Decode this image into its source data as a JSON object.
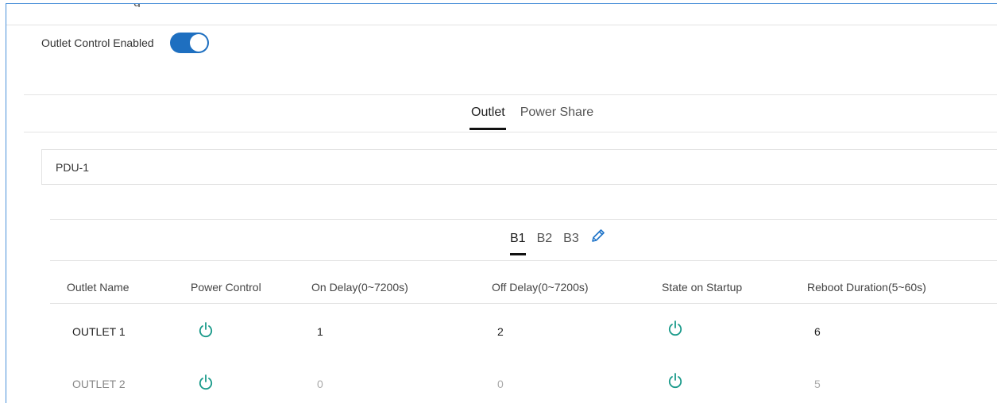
{
  "header": {
    "title_fragment": "g"
  },
  "outlet_control": {
    "label": "Outlet Control Enabled",
    "enabled": true
  },
  "main_tabs": [
    {
      "label": "Outlet",
      "active": true
    },
    {
      "label": "Power Share",
      "active": false
    }
  ],
  "pdu": {
    "name": "PDU-1"
  },
  "bank_tabs": [
    {
      "label": "B1",
      "active": true
    },
    {
      "label": "B2",
      "active": false
    },
    {
      "label": "B3",
      "active": false
    }
  ],
  "table": {
    "columns": [
      "Outlet Name",
      "Power Control",
      "On Delay(0~7200s)",
      "Off Delay(0~7200s)",
      "State on Startup",
      "Reboot Duration(5~60s)"
    ],
    "rows": [
      {
        "name": "OUTLET 1",
        "on_delay": "1",
        "off_delay": "2",
        "reboot": "6",
        "active": true
      },
      {
        "name": "OUTLET 2",
        "on_delay": "0",
        "off_delay": "0",
        "reboot": "5",
        "active": false
      }
    ]
  },
  "colors": {
    "toggle_on": "#1e6fc0",
    "power_icon": "#1a9a8a",
    "edit_icon": "#1e73c8",
    "frame_border": "#4a90d9"
  },
  "icons": {
    "power": "power-icon",
    "edit": "pencil-icon"
  }
}
